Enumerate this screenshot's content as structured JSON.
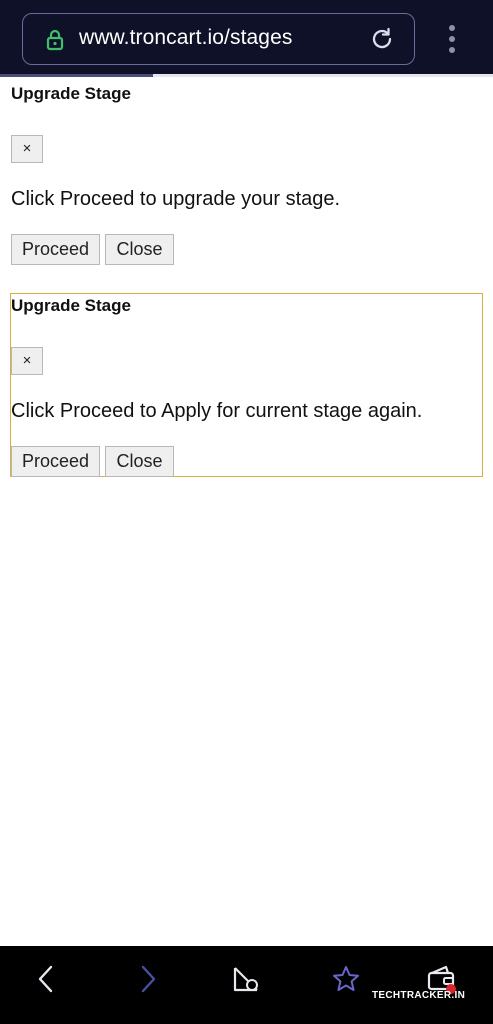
{
  "browser": {
    "url": "www.troncart.io/stages",
    "load_progress": 0.31
  },
  "dialogs": [
    {
      "title": "Upgrade Stage",
      "close_glyph": "×",
      "message": "Click Proceed to upgrade your stage.",
      "proceed_label": "Proceed",
      "close_label": "Close"
    },
    {
      "title": "Upgrade Stage",
      "close_glyph": "×",
      "message": "Click Proceed to Apply for current stage again.",
      "proceed_label": "Proceed",
      "close_label": "Close"
    }
  ],
  "bottom_nav": {
    "icons": [
      "back-icon",
      "forward-icon",
      "tabs-icon",
      "bookmark-star-icon",
      "wallet-icon"
    ]
  },
  "watermark": "TECHTRACKER.IN",
  "colors": {
    "toolbar_bg": "#0e1128",
    "focus_border": "#d4b23a",
    "lock_green": "#3fbf6a",
    "forward_purple": "#4a4fa3",
    "star_purple": "#6a66c8"
  }
}
